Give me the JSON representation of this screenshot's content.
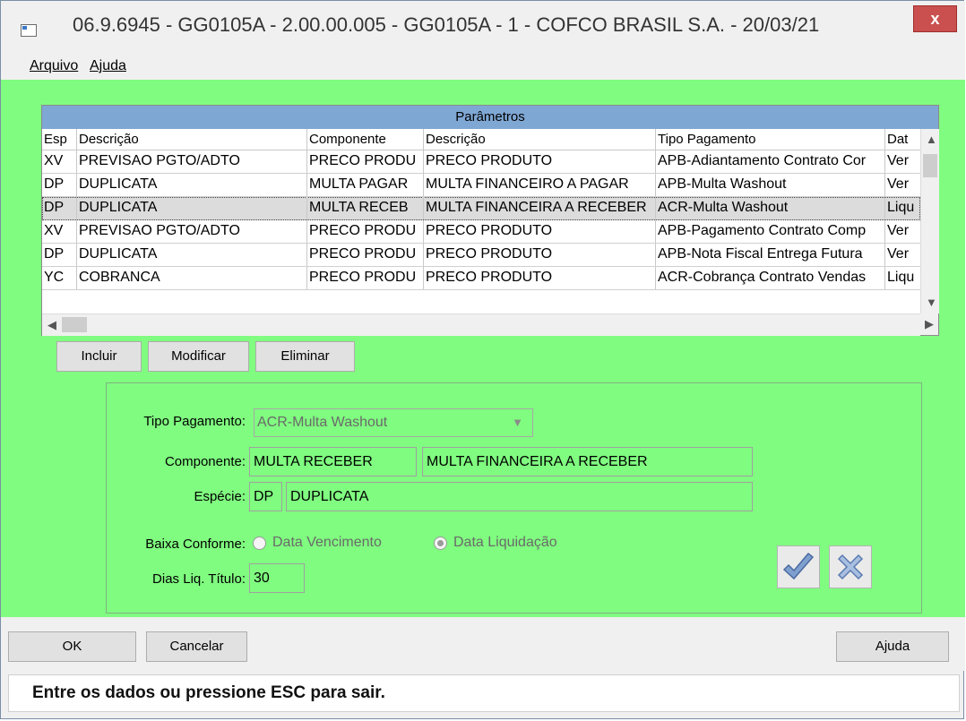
{
  "window": {
    "title": "06.9.6945 - GG0105A - 2.00.00.005 - GG0105A - 1 - COFCO BRASIL S.A. - 20/03/21",
    "close_label": "x"
  },
  "menu": {
    "arquivo": "Arquivo",
    "ajuda": "Ajuda"
  },
  "grid": {
    "title": "Parâmetros",
    "columns": [
      "Esp",
      "Descrição",
      "Componente",
      "Descrição",
      "Tipo Pagamento",
      "Dat"
    ],
    "rows": [
      [
        "XV",
        "PREVISAO PGTO/ADTO",
        "PRECO PRODU",
        "PRECO PRODUTO",
        "APB-Adiantamento Contrato Cor",
        "Ver"
      ],
      [
        "DP",
        "DUPLICATA",
        "MULTA PAGAR",
        "MULTA FINANCEIRO A PAGAR",
        "APB-Multa Washout",
        "Ver"
      ],
      [
        "DP",
        "DUPLICATA",
        "MULTA RECEB",
        "MULTA FINANCEIRA A RECEBER",
        "ACR-Multa Washout",
        "Liqu"
      ],
      [
        "XV",
        "PREVISAO PGTO/ADTO",
        "PRECO PRODU",
        "PRECO PRODUTO",
        "APB-Pagamento Contrato Comp",
        "Ver"
      ],
      [
        "DP",
        "DUPLICATA",
        "PRECO PRODU",
        "PRECO PRODUTO",
        "APB-Nota Fiscal Entrega Futura",
        "Ver"
      ],
      [
        "YC",
        "COBRANCA",
        "PRECO PRODU",
        "PRECO PRODUTO",
        "ACR-Cobrança Contrato Vendas",
        "Liqu"
      ]
    ],
    "selected_row": 2
  },
  "grid_buttons": {
    "incluir": "Incluir",
    "modificar": "Modificar",
    "eliminar": "Eliminar"
  },
  "form": {
    "tipo_pagamento_label": "Tipo Pagamento:",
    "tipo_pagamento_value": "ACR-Multa Washout",
    "componente_label": "Componente:",
    "componente_code": "MULTA RECEBER",
    "componente_desc": "MULTA FINANCEIRA A RECEBER",
    "especie_label": "Espécie:",
    "especie_code": "DP",
    "especie_desc": "DUPLICATA",
    "baixa_label": "Baixa Conforme:",
    "radio_vencimento": "Data Vencimento",
    "radio_liquidacao": "Data Liquidação",
    "radio_selected": "Data Liquidação",
    "dias_label": "Dias Liq. Título:",
    "dias_value": "30"
  },
  "bottom": {
    "ok": "OK",
    "cancelar": "Cancelar",
    "ajuda": "Ajuda"
  },
  "status": {
    "message": "Entre os dados ou pressione ESC para sair."
  },
  "colors": {
    "client_bg": "#80fc80",
    "grid_header": "#7fa7d4",
    "close_button": "#c9504e"
  }
}
